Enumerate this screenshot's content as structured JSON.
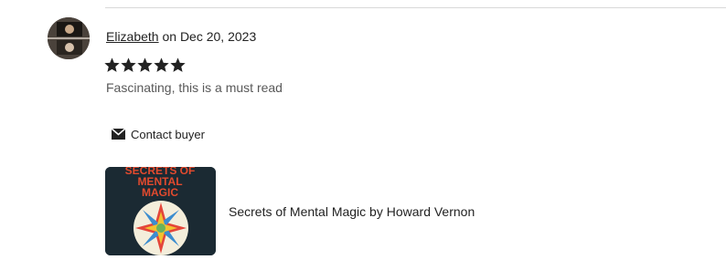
{
  "review": {
    "reviewer_name": "Elizabeth",
    "date_text": "on Dec 20, 2023",
    "rating": 5,
    "rating_max": 5,
    "text": "Fascinating, this is a must read"
  },
  "actions": {
    "contact_label": "Contact buyer"
  },
  "item": {
    "title": "Secrets of Mental Magic by Howard Vernon",
    "cover_text_line1": "SECRETS OF",
    "cover_text_line2": "MENTAL",
    "cover_text_line3": "MAGIC"
  },
  "colors": {
    "star": "#222222",
    "cover_bg": "#1b2a33",
    "cover_text": "#e24a2e"
  },
  "icons": {
    "star": "star-icon",
    "contact": "envelope-icon"
  }
}
